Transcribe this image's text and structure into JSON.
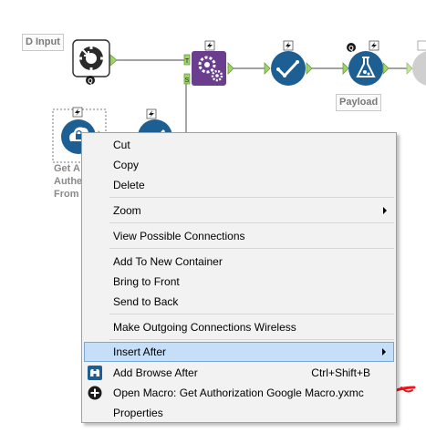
{
  "canvas": {
    "input_label": "D Input",
    "payload_label": "Payload",
    "auth_label_lines": [
      "Get A",
      "Authe",
      "From "
    ]
  },
  "context_menu": {
    "cut": "Cut",
    "copy": "Copy",
    "delete": "Delete",
    "zoom": "Zoom",
    "view_connections": "View Possible Connections",
    "add_container": "Add To New Container",
    "bring_front": "Bring to Front",
    "send_back": "Send to Back",
    "wireless": "Make Outgoing Connections Wireless",
    "insert_after": "Insert After",
    "add_browse_after": "Add Browse After",
    "add_browse_shortcut": "Ctrl+Shift+B",
    "open_macro": "Open Macro: Get Authorization Google Macro.yxmc",
    "properties": "Properties"
  },
  "colors": {
    "tool_blue": "#1e5f93",
    "developer_purple": "#6a3d8f",
    "connector_green": "#9fd36b",
    "menu_highlight": "#c5dff8",
    "annotation_red": "#e8171b"
  }
}
